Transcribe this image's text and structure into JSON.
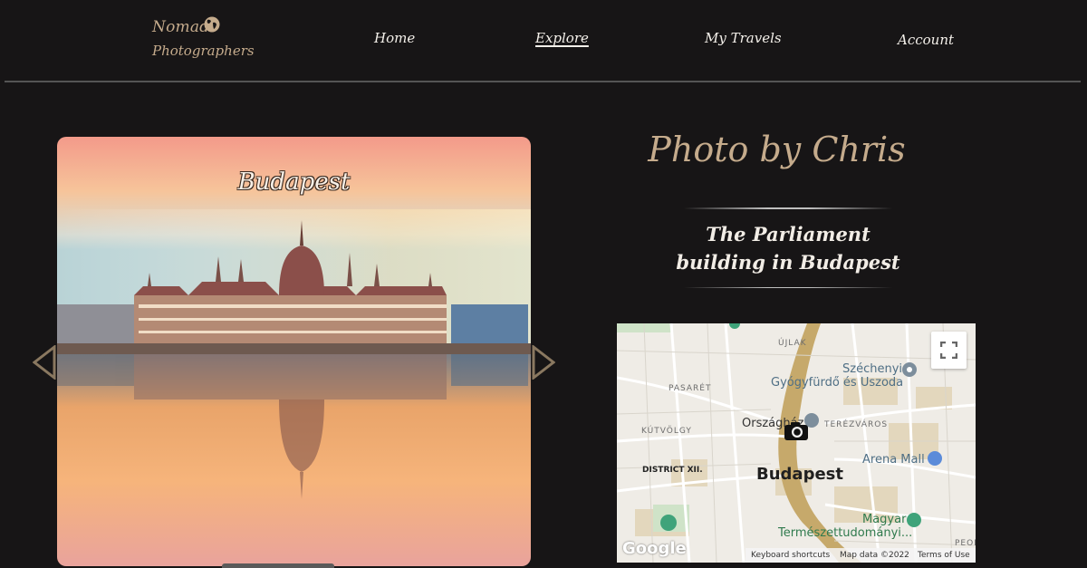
{
  "logo": {
    "line1": "Nomad",
    "line2": "Photographers",
    "icon": "globe-icon"
  },
  "nav": {
    "home": "Home",
    "explore": "Explore",
    "my_travels": "My Travels",
    "account": "Account",
    "active": "Explore"
  },
  "carousel": {
    "caption": "Budapest",
    "prev_icon": "triangle-left-icon",
    "next_icon": "triangle-right-icon"
  },
  "photo_info": {
    "title": "Photo by Chris",
    "description": "The Parliament building in Budapest"
  },
  "map": {
    "labels": {
      "ujlak": "ÚJLAK",
      "pasaret": "PASARÉT",
      "szechenyi_line1": "Széchenyi",
      "szechenyi_line2": "Gyógyfürdő és Uszoda",
      "orszaghaz": "Országház",
      "terezvaros": "TERÉZVÁROS",
      "kutvolgy": "KÚTVÖLGY",
      "arena_mall": "Arena Mall",
      "district": "DISTRICT XII.",
      "city": "Budapest",
      "magyar": "Magyar",
      "termeszet": "Természettudományi...",
      "peopl": "PEOPL"
    },
    "google": "Google",
    "footer": {
      "shortcuts": "Keyboard shortcuts",
      "map_data": "Map data ©2022",
      "terms": "Terms of Use"
    },
    "fullscreen_icon": "fullscreen-icon",
    "marker_icon": "camera-icon"
  },
  "colors": {
    "background": "#171516",
    "accent": "#c5ab8c",
    "text": "#f2ede6"
  }
}
